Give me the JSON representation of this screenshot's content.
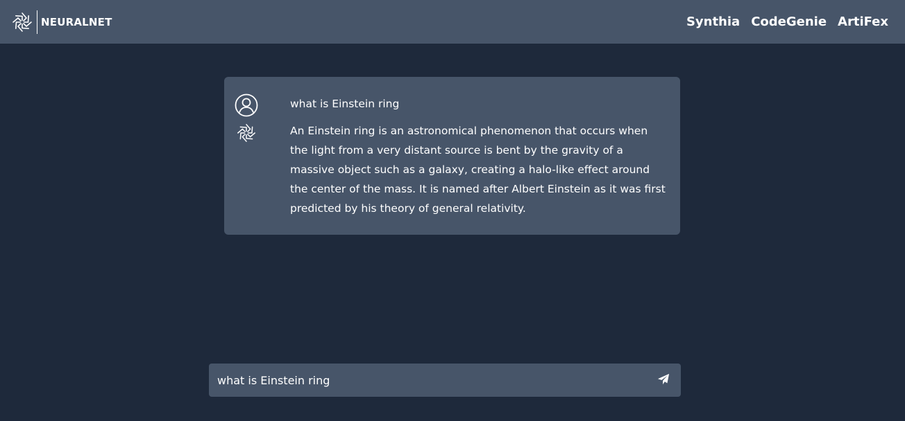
{
  "header": {
    "brand_name": "NEURALNET",
    "logo_icon": "neuralnet-swirl-logo",
    "nav": [
      {
        "label": "Synthia"
      },
      {
        "label": "CodeGenie"
      },
      {
        "label": "ArtiFex"
      }
    ]
  },
  "conversation": {
    "user_message": {
      "avatar_icon": "user-circle-icon",
      "text": "what is Einstein ring"
    },
    "bot_message": {
      "avatar_icon": "neuralnet-swirl-icon",
      "text": "An Einstein ring is an astronomical phenomenon that occurs when the light from a very distant source is bent by the gravity of a massive object such as a galaxy, creating a halo-like effect around the center of the mass. It is named after Albert Einstein as it was first predicted by his theory of general relativity."
    }
  },
  "composer": {
    "value": "what is Einstein ring",
    "send_icon": "paper-plane-icon"
  },
  "colors": {
    "background": "#1e293b",
    "surface": "#475569",
    "text": "#ffffff"
  }
}
